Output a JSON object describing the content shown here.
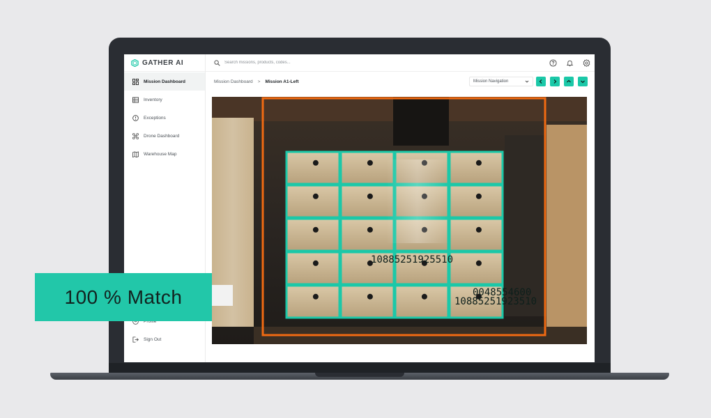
{
  "brand": {
    "name": "GATHER AI",
    "accent": "#1bc8a8"
  },
  "search": {
    "placeholder": "Search missions, products, codes..."
  },
  "top_icons": [
    "help-icon",
    "bell-icon",
    "settings-icon"
  ],
  "sidebar": {
    "items": [
      {
        "label": "Mission Dashboard",
        "icon": "dashboard-icon",
        "active": true
      },
      {
        "label": "Inventory",
        "icon": "list-icon",
        "active": false
      },
      {
        "label": "Exceptions",
        "icon": "alert-icon",
        "active": false
      },
      {
        "label": "Drone Dashboard",
        "icon": "drone-icon",
        "active": false
      },
      {
        "label": "Warehouse Map",
        "icon": "map-icon",
        "active": false
      }
    ],
    "bottom": [
      {
        "label": "Profile",
        "icon": "user-icon"
      },
      {
        "label": "Sign Out",
        "icon": "sign-out-icon"
      }
    ]
  },
  "breadcrumb": {
    "parent": "Mission Dashboard",
    "separator": ">",
    "current": "Mission A1-Left"
  },
  "mission_nav": {
    "label": "Mission Navigation"
  },
  "nav_buttons": [
    "prev-icon",
    "next-icon",
    "up-icon",
    "down-icon"
  ],
  "detections": {
    "barcode_1": "10885251925510",
    "barcode_2": "0048554600",
    "barcode_3": "10885251923510",
    "box_color": "#1bc8a8",
    "frame_color": "#f06a12"
  },
  "badge": {
    "text": "100 % Match"
  }
}
